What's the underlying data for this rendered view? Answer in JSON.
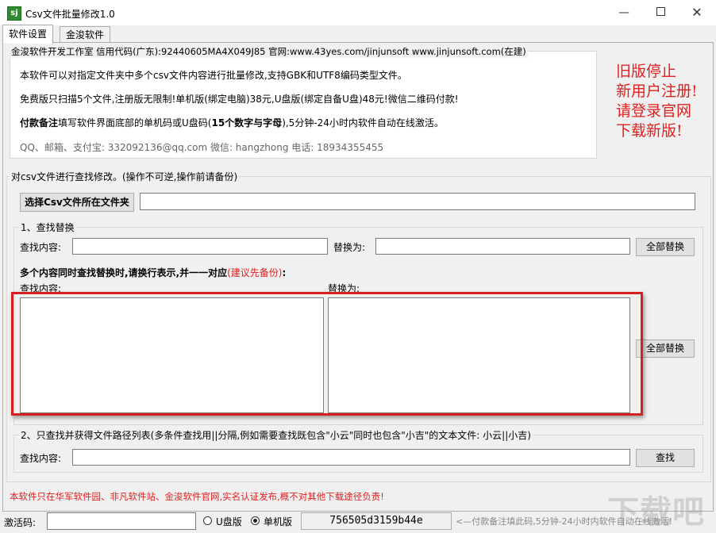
{
  "window": {
    "title": "Csv文件批量修改1.0",
    "icon_text": "sj"
  },
  "tabs": [
    {
      "label": "软件设置",
      "active": true
    },
    {
      "label": "金浚软件",
      "active": false
    }
  ],
  "info": {
    "group_title": "金浚软件开发工作室 信用代码(广东):92440605MA4X049J85 官网:www.43yes.com/jinjunsoft  www.jinjunsoft.com(在建)",
    "line1": "本软件可以对指定文件夹中多个csv文件内容进行批量修改,支持GBK和UTF8编码类型文件。",
    "line2": "免费版只扫描5个文件,注册版无限制!单机版(绑定电脑)38元,U盘版(绑定自备U盘)48元!微信二维码付款!",
    "line3_bold": "付款备注",
    "line3_a": "填写软件界面底部的单机码或U盘码(",
    "line3_bold2": "15个数字与字母",
    "line3_b": "),5分钟-24小时内软件自动在线激活。",
    "line4": "QQ、邮箱、支付宝: 332092136@qq.com    微信: hangzhong    电话: 18934355455"
  },
  "notice": {
    "line1": "旧版停止",
    "line2": "新用户注册!",
    "line3": "请登录官网",
    "line4": "下载新版!",
    "color": "#e02020"
  },
  "main_group": {
    "title": "对csv文件进行查找修改。(操作不可逆,操作前请备份)",
    "select_folder_button": "选择Csv文件所在文件夹",
    "folder_path": ""
  },
  "find_replace": {
    "title": "1、查找替换",
    "find_label": "查找内容:",
    "find_value": "",
    "replace_label": "替换为:",
    "replace_value": "",
    "replace_all_button": "全部替换",
    "multi_hint": "多个内容同时查找替换时,请换行表示,并一一对应",
    "multi_hint_red": "(建议先备份)",
    "multi_hint_colon": ":",
    "multi_find_label": "查找内容:",
    "multi_replace_label": "替换为:",
    "multi_find_value": "",
    "multi_replace_value": "",
    "multi_replace_all_button": "全部替换"
  },
  "path_search": {
    "title": "2、只查找并获得文件路径列表(多条件查找用||分隔,例如需要查找既包含\"小云\"同时也包含\"小吉\"的文本文件: 小云||小吉)",
    "find_label": "查找内容:",
    "find_value": "",
    "search_button": "查找"
  },
  "disclaimer": "本软件只在华军软件园、非凡软件站、金浚软件官网,实名认证发布,概不对其他下载途径负责!",
  "status": {
    "activation_label": "激活码:",
    "activation_value": "",
    "option_usb": "U盘版",
    "option_single": "单机版",
    "selected_option": "单机版",
    "machine_code": "756505d3159b44e",
    "hint": "<—付款备注填此码,5分钟-24小时内软件自动在线激活!"
  },
  "watermark": "下载吧"
}
